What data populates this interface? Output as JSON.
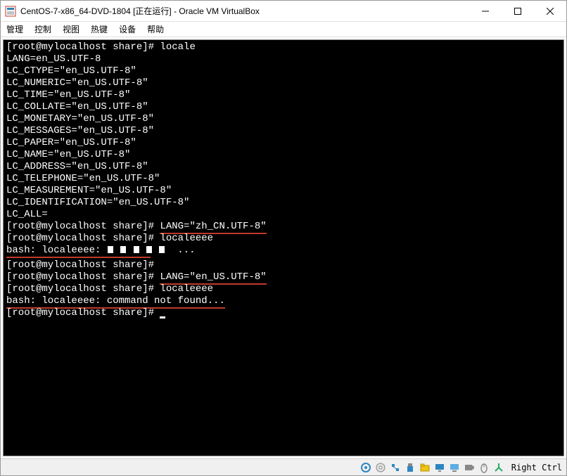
{
  "titlebar": {
    "title": "CentOS-7-x86_64-DVD-1804 [正在运行] - Oracle VM VirtualBox"
  },
  "menubar": {
    "items": [
      "管理",
      "控制",
      "视图",
      "热键",
      "设备",
      "帮助"
    ]
  },
  "terminal": {
    "lines": [
      {
        "type": "prompt_cmd",
        "prompt": "[root@mylocalhost share]#",
        "cmd": " locale"
      },
      {
        "type": "plain",
        "text": "LANG=en_US.UTF-8"
      },
      {
        "type": "plain",
        "text": "LC_CTYPE=\"en_US.UTF-8\""
      },
      {
        "type": "plain",
        "text": "LC_NUMERIC=\"en_US.UTF-8\""
      },
      {
        "type": "plain",
        "text": "LC_TIME=\"en_US.UTF-8\""
      },
      {
        "type": "plain",
        "text": "LC_COLLATE=\"en_US.UTF-8\""
      },
      {
        "type": "plain",
        "text": "LC_MONETARY=\"en_US.UTF-8\""
      },
      {
        "type": "plain",
        "text": "LC_MESSAGES=\"en_US.UTF-8\""
      },
      {
        "type": "plain",
        "text": "LC_PAPER=\"en_US.UTF-8\""
      },
      {
        "type": "plain",
        "text": "LC_NAME=\"en_US.UTF-8\""
      },
      {
        "type": "plain",
        "text": "LC_ADDRESS=\"en_US.UTF-8\""
      },
      {
        "type": "plain",
        "text": "LC_TELEPHONE=\"en_US.UTF-8\""
      },
      {
        "type": "plain",
        "text": "LC_MEASUREMENT=\"en_US.UTF-8\""
      },
      {
        "type": "plain",
        "text": "LC_IDENTIFICATION=\"en_US.UTF-8\""
      },
      {
        "type": "plain",
        "text": "LC_ALL="
      },
      {
        "type": "prompt_cmd_ul",
        "prompt": "[root@mylocalhost share]#",
        "cmd": "LANG=\"zh_CN.UTF-8\""
      },
      {
        "type": "prompt_cmd",
        "prompt": "[root@mylocalhost share]#",
        "cmd": " localeeee"
      },
      {
        "type": "bash_boxes",
        "prefix": "bash: localeeee: ",
        "suffix": " ..."
      },
      {
        "type": "red_line_only"
      },
      {
        "type": "prompt_only",
        "prompt": "[root@mylocalhost share]#"
      },
      {
        "type": "prompt_cmd_ul",
        "prompt": "[root@mylocalhost share]#",
        "cmd": "LANG=\"en_US.UTF-8\""
      },
      {
        "type": "prompt_cmd",
        "prompt": "[root@mylocalhost share]#",
        "cmd": " localeeee"
      },
      {
        "type": "bash_ul",
        "text": "bash: localeeee: command not found..."
      },
      {
        "type": "prompt_cursor",
        "prompt": "[root@mylocalhost share]#"
      }
    ]
  },
  "statusbar": {
    "host_key": "Right Ctrl",
    "icons": [
      "disc",
      "cd",
      "network",
      "usb",
      "shared",
      "display",
      "audio",
      "record",
      "mouse",
      "keyboard"
    ]
  }
}
